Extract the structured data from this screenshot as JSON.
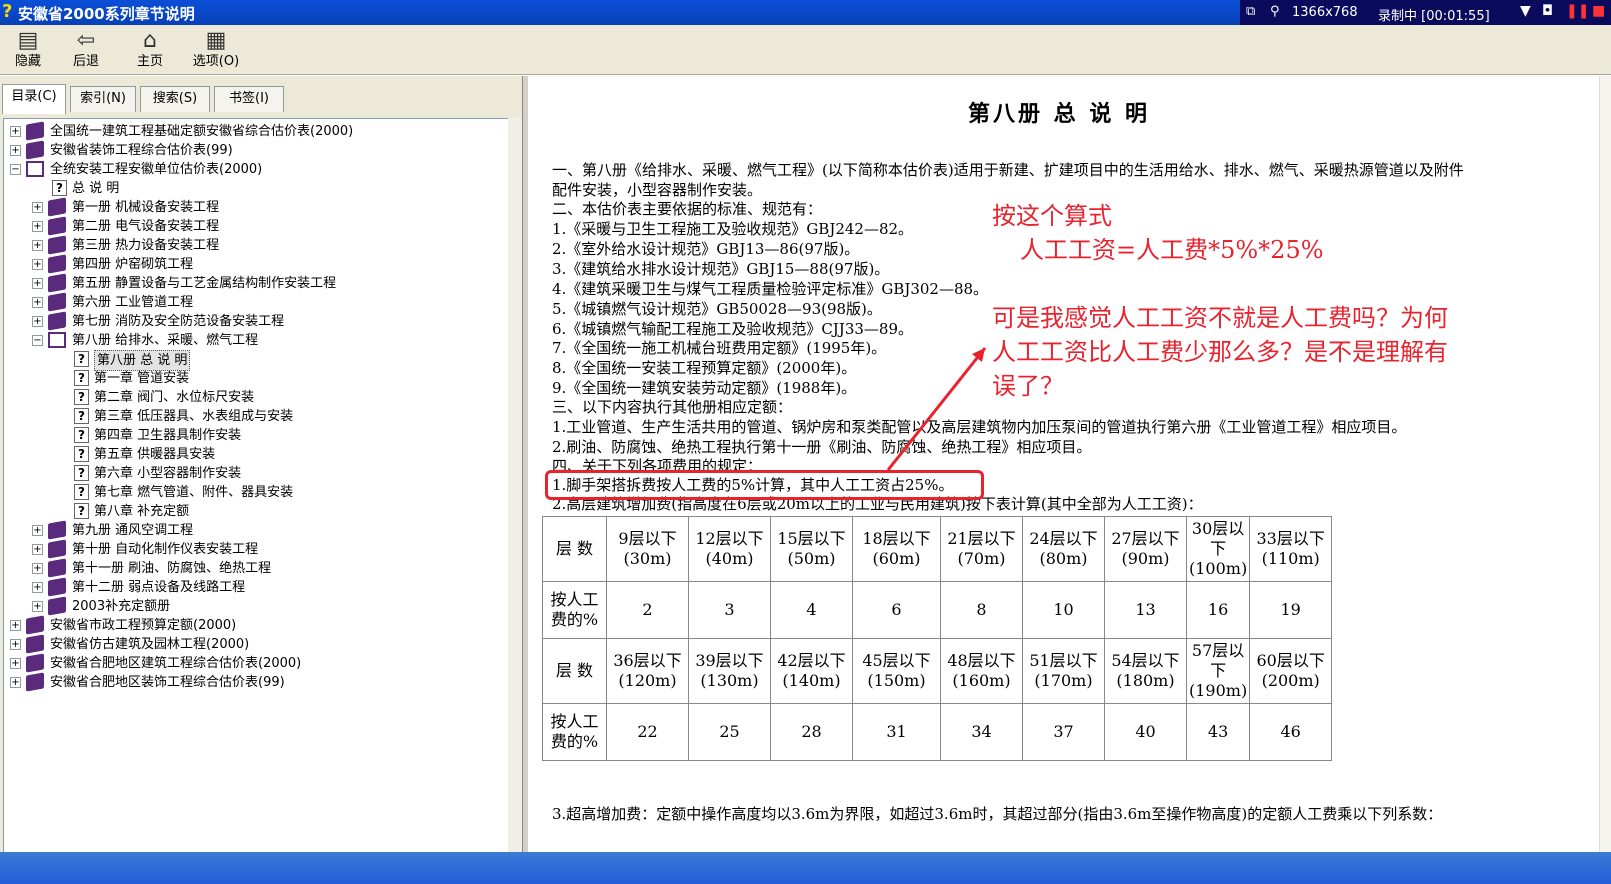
{
  "window": {
    "title": "安徽省2000系列章节说明",
    "rec_resolution": "1366x768",
    "rec_status": "录制中 [00:01:55]"
  },
  "toolbar": {
    "hide": "隐藏",
    "back": "后退",
    "home": "主页",
    "options": "选项(O)"
  },
  "tabs": [
    "目录(C)",
    "索引(N)",
    "搜索(S)",
    "书签(I)"
  ],
  "tree": [
    {
      "label": "全国统一建筑工程基础定额安徽省综合估价表(2000)"
    },
    {
      "label": "安徽省装饰工程综合估价表(99)"
    },
    {
      "label": "全统安装工程安徽单位估价表(2000)"
    },
    {
      "label": "总 说 明"
    },
    {
      "label": "第一册 机械设备安装工程"
    },
    {
      "label": "第二册 电气设备安装工程"
    },
    {
      "label": "第三册 热力设备安装工程"
    },
    {
      "label": "第四册 炉窑砌筑工程"
    },
    {
      "label": "第五册 静置设备与工艺金属结构制作安装工程"
    },
    {
      "label": "第六册 工业管道工程"
    },
    {
      "label": "第七册 消防及安全防范设备安装工程"
    },
    {
      "label": "第八册 给排水、采暖、燃气工程"
    },
    {
      "label": "第八册 总 说 明"
    },
    {
      "label": "第一章 管道安装"
    },
    {
      "label": "第二章 阀门、水位标尺安装"
    },
    {
      "label": "第三章 低压器具、水表组成与安装"
    },
    {
      "label": "第四章 卫生器具制作安装"
    },
    {
      "label": "第五章 供暖器具安装"
    },
    {
      "label": "第六章 小型容器制作安装"
    },
    {
      "label": "第七章 燃气管道、附件、器具安装"
    },
    {
      "label": "第八章 补充定额"
    },
    {
      "label": "第九册 通风空调工程"
    },
    {
      "label": "第十册 自动化制作仪表安装工程"
    },
    {
      "label": "第十一册 刷油、防腐蚀、绝热工程"
    },
    {
      "label": "第十二册 弱点设备及线路工程"
    },
    {
      "label": "2003补充定额册"
    },
    {
      "label": "安徽省市政工程预算定额(2000)"
    },
    {
      "label": "安徽省仿古建筑及园林工程(2000)"
    },
    {
      "label": "安徽省合肥地区建筑工程综合估价表(2000)"
    },
    {
      "label": "安徽省合肥地区装饰工程综合估价表(99)"
    }
  ],
  "doc": {
    "title": "第八册 总 说 明",
    "lines": [
      "一、第八册《给排水、采暖、燃气工程》(以下简称本估价表)适用于新建、扩建项目中的生活用给水、排水、燃气、采暖热源管道以及附件",
      "配件安装，小型容器制作安装。",
      "二、本估价表主要依据的标准、规范有：",
      "1.《采暖与卫生工程施工及验收规范》GBJ242—82。",
      "2.《室外给水设计规范》GBJ13—86(97版)。",
      "3.《建筑给水排水设计规范》GBJ15—88(97版)。",
      "4.《建筑采暖卫生与煤气工程质量检验评定标准》GBJ302—88。",
      "5.《城镇燃气设计规范》GB50028—93(98版)。",
      "6.《城镇燃气输配工程施工及验收规范》CJJ33—89。",
      "7.《全国统一施工机械台班费用定额》(1995年)。",
      "8.《全国统一安装工程预算定额》(2000年)。",
      "9.《全国统一建筑安装劳动定额》(1988年)。",
      "三、以下内容执行其他册相应定额：",
      "1.工业管道、生产生活共用的管道、锅炉房和泵类配管以及高层建筑物内加压泵间的管道执行第六册《工业管道工程》相应项目。",
      "2.刷油、防腐蚀、绝热工程执行第十一册《刷油、防腐蚀、绝热工程》相应项目。",
      "四、关于下列各项费用的规定：",
      "1.脚手架搭拆费按人工费的5%计算，其中人工工资占25%。",
      "2.高层建筑增加费(指高度在6层或20m以上的工业与民用建筑)按下表计算(其中全部为人工工资)：",
      "3.超高增加费：定额中操作高度均以3.6m为界限，如超过3.6m时，其超过部分(指由3.6m至操作物高度)的定额人工费乘以下列系数："
    ]
  },
  "annotation": {
    "line1": "按这个算式",
    "line2": "人工工资=人工费*5%*25%",
    "line3": "可是我感觉人工工资不就是人工费吗？为何",
    "line4": "人工工资比人工费少那么多？是不是理解有",
    "line5": "误了？",
    "color": "#e8232e"
  },
  "table": {
    "row_label_floors": "层 数",
    "row_label_percent": "按人工费的%",
    "floors1": [
      "9层以下(30m)",
      "12层以下(40m)",
      "15层以下(50m)",
      "18层以下(60m)",
      "21层以下(70m)",
      "24层以下(80m)",
      "27层以下(90m)",
      "30层以下(100m)",
      "33层以下(110m)"
    ],
    "pct1": [
      "2",
      "3",
      "4",
      "6",
      "8",
      "10",
      "13",
      "16",
      "19"
    ],
    "floors2": [
      "36层以下(120m)",
      "39层以下(130m)",
      "42层以下(140m)",
      "45层以下(150m)",
      "48层以下(160m)",
      "51层以下(170m)",
      "54层以下(180m)",
      "57层以下(190m)",
      "60层以下(200m)"
    ],
    "pct2": [
      "22",
      "25",
      "28",
      "31",
      "34",
      "37",
      "40",
      "43",
      "46"
    ]
  }
}
